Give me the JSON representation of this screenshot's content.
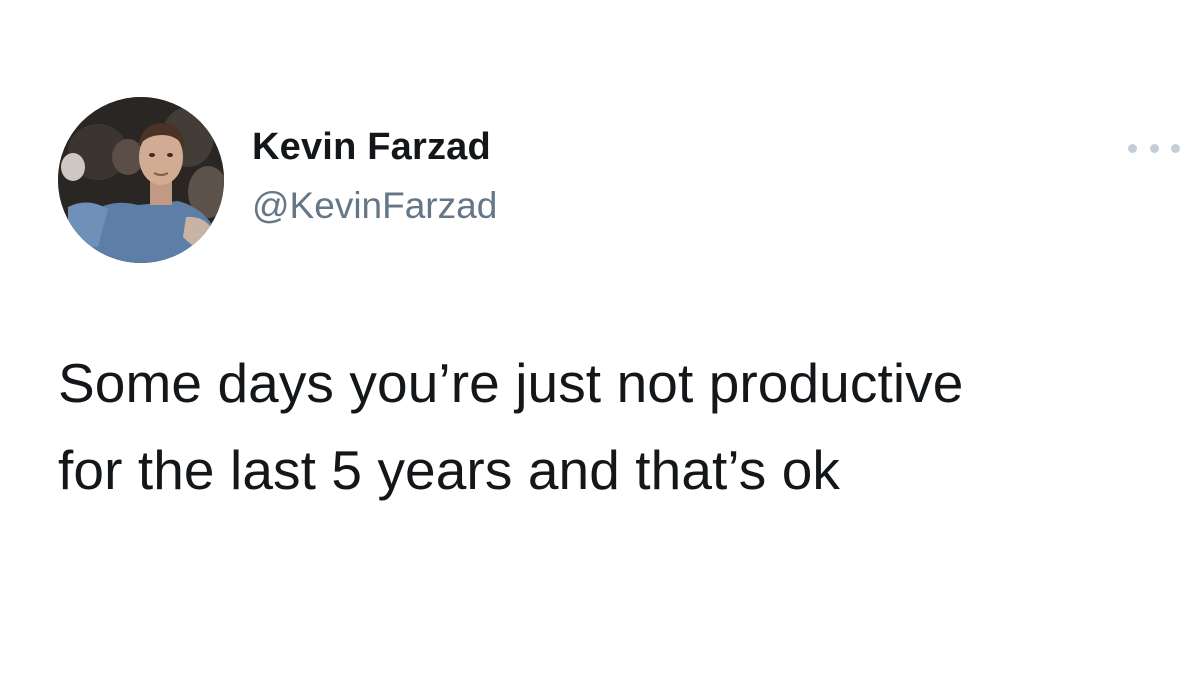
{
  "tweet": {
    "author": {
      "display_name": "Kevin Farzad",
      "handle": "@KevinFarzad",
      "avatar_icon": "profile-photo"
    },
    "more_icon": "more-options-icon",
    "text_lines": [
      "Some days you’re just not productive",
      "for the last 5 years and that’s ok"
    ]
  },
  "colors": {
    "background": "#ffffff",
    "name": "#14171a",
    "handle": "#657786",
    "body_text": "#14171a",
    "more_dots": "#c4cdd5"
  }
}
